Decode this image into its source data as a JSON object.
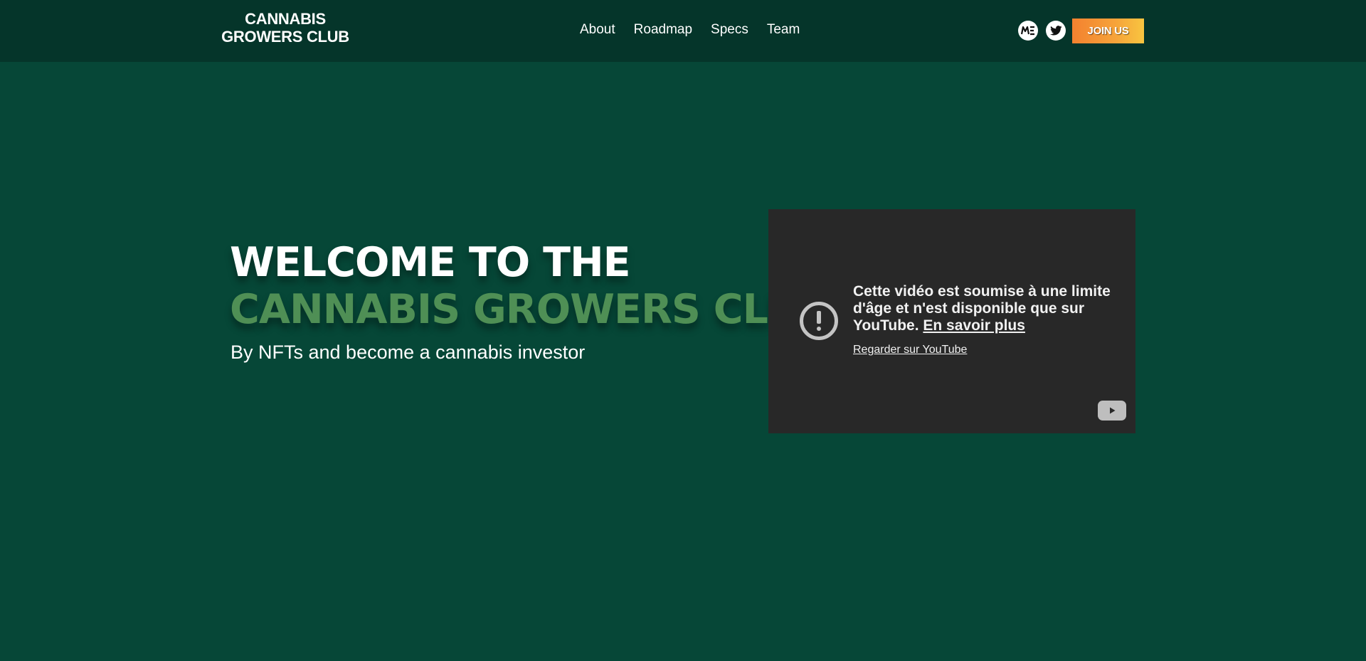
{
  "brand": {
    "line1": "CANNABIS",
    "line2": "GROWERS CLUB"
  },
  "nav": {
    "items": [
      {
        "label": "About"
      },
      {
        "label": "Roadmap"
      },
      {
        "label": "Specs"
      },
      {
        "label": "Team"
      }
    ]
  },
  "social": {
    "magic_eden_icon": "magic-eden-icon",
    "twitter_icon": "twitter-icon"
  },
  "join_button": {
    "label": "JOIN US"
  },
  "hero": {
    "title_line1": "WELCOME TO THE",
    "title_line2": "CANNABIS GROWERS CLUB",
    "subtitle": "By NFTs and become a cannabis investor"
  },
  "video": {
    "message": "Cette vidéo est soumise à une limite d'âge et n'est disponible que sur YouTube.",
    "learn_more": "En savoir plus",
    "watch_link": "Regarder sur YouTube"
  },
  "colors": {
    "background": "#064737",
    "navbar": "#05352a",
    "accent_green": "#4f8f55",
    "join_gradient_start": "#f3812f",
    "join_gradient_end": "#f8c540",
    "video_bg": "#282828"
  }
}
